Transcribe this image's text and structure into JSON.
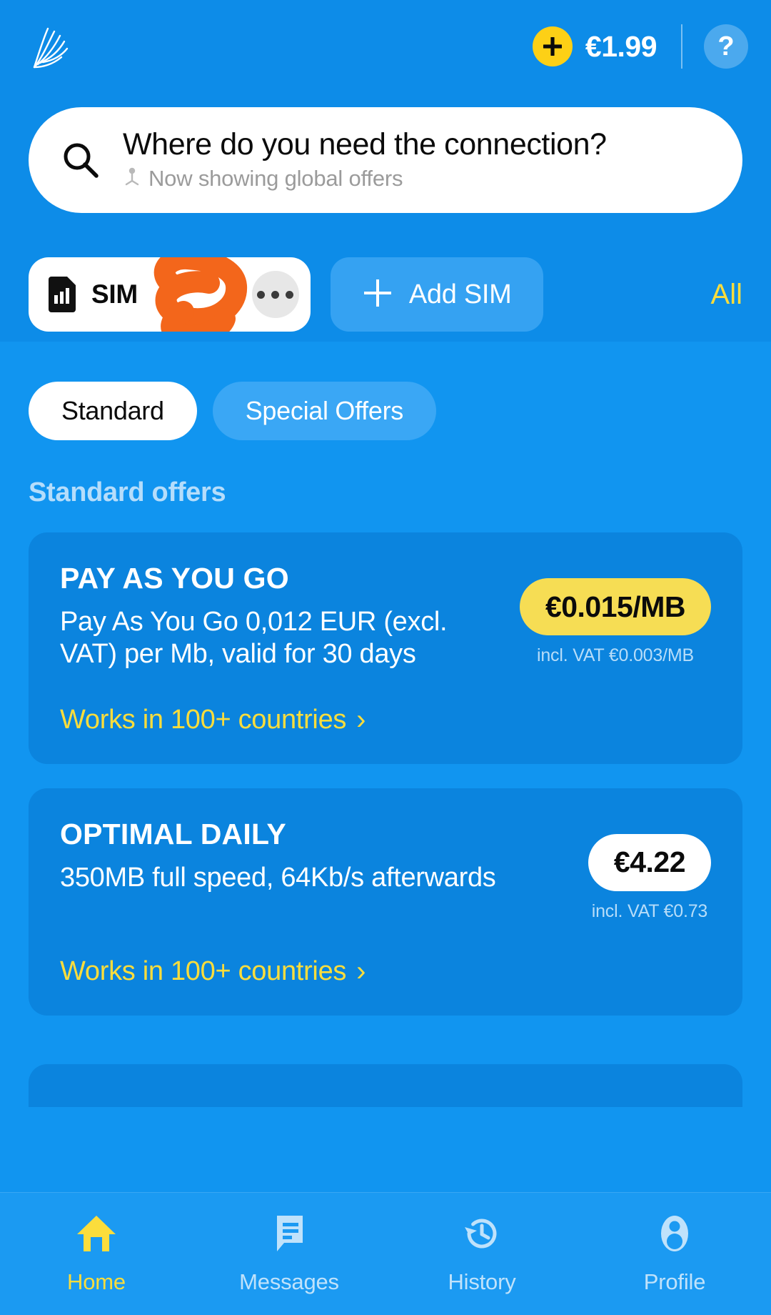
{
  "header": {
    "logo_name": "feather-logo",
    "add_balance_icon": "plus-icon",
    "balance": "€1.99",
    "help_label": "?"
  },
  "search": {
    "icon": "search-icon",
    "title": "Where do you need the connection?",
    "location_icon": "location-pin-icon",
    "subtitle": "Now showing global offers"
  },
  "sim_row": {
    "sim_icon": "sim-card-icon",
    "sim_label": "SIM",
    "redaction_note": "orange-scribble-redaction",
    "more_icon": "more-options-icon",
    "add_sim_label": "Add SIM",
    "add_sim_icon": "plus-icon",
    "all_label": "All"
  },
  "tabs": [
    {
      "label": "Standard",
      "active": true
    },
    {
      "label": "Special Offers",
      "active": false
    }
  ],
  "section": {
    "heading": "Standard offers"
  },
  "offers": [
    {
      "title": "PAY AS YOU GO",
      "description": "Pay As You Go 0,012 EUR (excl. VAT) per Mb, valid for 30 days",
      "price": "€0.015/MB",
      "price_style": "yellow",
      "vat_note": "incl. VAT €0.003/MB",
      "link": "Works in 100+ countries",
      "link_chevron": "›"
    },
    {
      "title": "OPTIMAL DAILY",
      "description": "350MB full speed, 64Kb/s afterwards",
      "price": "€4.22",
      "price_style": "white",
      "vat_note": "incl. VAT €0.73",
      "link": "Works in 100+ countries",
      "link_chevron": "›"
    }
  ],
  "bottom_nav": [
    {
      "label": "Home",
      "icon": "home-icon",
      "active": true
    },
    {
      "label": "Messages",
      "icon": "message-icon",
      "active": false
    },
    {
      "label": "History",
      "icon": "history-clock-icon",
      "active": false
    },
    {
      "label": "Profile",
      "icon": "person-icon",
      "active": false
    }
  ],
  "colors": {
    "brand_blue": "#0d8ce8",
    "body_blue": "#1195f0",
    "card_blue": "#0b84de",
    "accent_yellow": "#fbdd3c",
    "badge_yellow": "#f6dd54",
    "nav_blue": "#1b9af2",
    "redaction_orange": "#f3661b"
  }
}
